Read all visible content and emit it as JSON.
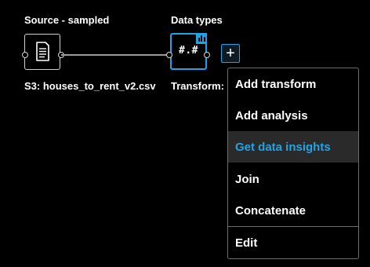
{
  "canvas": {
    "source_node": {
      "title": "Source - sampled",
      "caption": "S3: houses_to_rent_v2.csv",
      "icon": "document-icon"
    },
    "transform_node": {
      "title": "Data types",
      "caption": "Transform: h",
      "icon_text": "#.#",
      "badge_icon": "bar-chart-icon"
    },
    "add_button_label": "+"
  },
  "menu": {
    "items": [
      {
        "label": "Add transform"
      },
      {
        "label": "Add analysis"
      },
      {
        "label": "Get data insights",
        "highlighted": true
      },
      {
        "label": "Join"
      },
      {
        "label": "Concatenate"
      },
      {
        "label": "Edit"
      }
    ]
  },
  "colors": {
    "background": "#000000",
    "accent": "#1fa3e6",
    "menu_hover": "#2a2a2a",
    "text": "#ffffff"
  }
}
